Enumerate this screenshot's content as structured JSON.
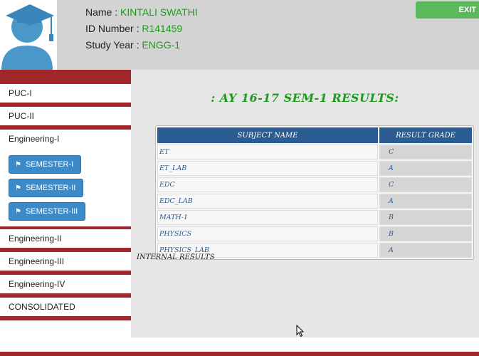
{
  "student": {
    "name_label": "Name : ",
    "name_value": "KINTALI SWATHI",
    "id_label": "ID Number : ",
    "id_value": "R141459",
    "year_label": "Study Year : ",
    "year_value": "ENGG-1"
  },
  "exit_label": "EXIT",
  "sidebar": {
    "items": [
      "PUC-I",
      "PUC-II",
      "Engineering-I",
      "Engineering-II",
      "Engineering-III",
      "Engineering-IV",
      "CONSOLIDATED"
    ],
    "semesters": [
      "SEMESTER-I",
      "SEMESTER-II",
      "SEMESTER-III"
    ]
  },
  "results": {
    "title": ": AY 16-17 SEM-1 RESULTS:",
    "headers": [
      "SUBJECT NAME",
      "RESULT GRADE"
    ],
    "rows": [
      [
        "ET",
        "C"
      ],
      [
        "ET_LAB",
        "A"
      ],
      [
        "EDC",
        "C"
      ],
      [
        "EDC_LAB",
        "A"
      ],
      [
        "MATH-1",
        "B"
      ],
      [
        "PHYSICS",
        "B"
      ],
      [
        "PHYSICS_LAB",
        "A"
      ]
    ]
  },
  "internal_label": "INTERNAL RESULTS",
  "colors": {
    "accent_red": "#a0282a",
    "button_blue": "#3d8ac8",
    "table_header": "#2b5c91",
    "green_text": "#1e9a1e",
    "exit_green": "#5cb85c"
  }
}
